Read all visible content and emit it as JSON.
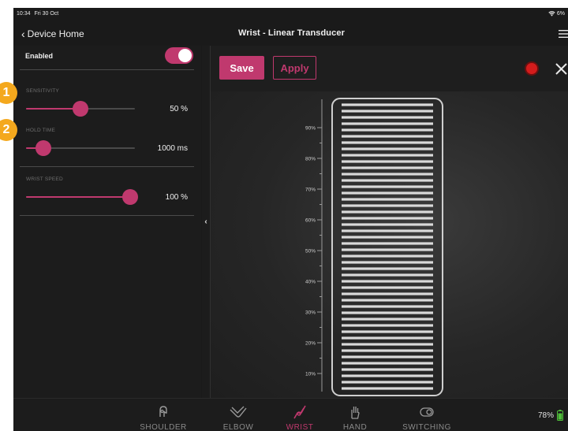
{
  "status_bar": {
    "time": "10:34",
    "date": "Fri 30 Oct",
    "battery": "6%"
  },
  "nav": {
    "back_label": "Device Home",
    "title": "Wrist - Linear Transducer"
  },
  "settings": {
    "enabled_label": "Enabled",
    "enabled": true,
    "sensitivity": {
      "label": "SENSITIVITY",
      "value": "50 %",
      "level": 0.5
    },
    "hold_time": {
      "label": "HOLD TIME",
      "value": "1000 ms",
      "level": 0.16
    },
    "wrist_speed": {
      "label": "WRIST SPEED",
      "value": "100 %",
      "level": 1.0
    }
  },
  "toolbar": {
    "save_label": "Save",
    "apply_label": "Apply"
  },
  "gauge": {
    "tick_labels": [
      "90%",
      "80%",
      "70%",
      "60%",
      "50%",
      "40%",
      "30%",
      "20%",
      "10%"
    ],
    "bar_count": 46
  },
  "tabs": [
    {
      "label": "SHOULDER",
      "icon": "shoulder-icon",
      "active": false
    },
    {
      "label": "ELBOW",
      "icon": "elbow-icon",
      "active": false
    },
    {
      "label": "WRIST",
      "icon": "wrist-icon",
      "active": true
    },
    {
      "label": "HAND",
      "icon": "hand-icon",
      "active": false
    },
    {
      "label": "SWITCHING",
      "icon": "switching-icon",
      "active": false
    }
  ],
  "device_battery": "78%",
  "badges": [
    "1",
    "2"
  ],
  "colors": {
    "accent": "#c0396e",
    "badge": "#f4a81d",
    "record": "#d41c1c"
  }
}
